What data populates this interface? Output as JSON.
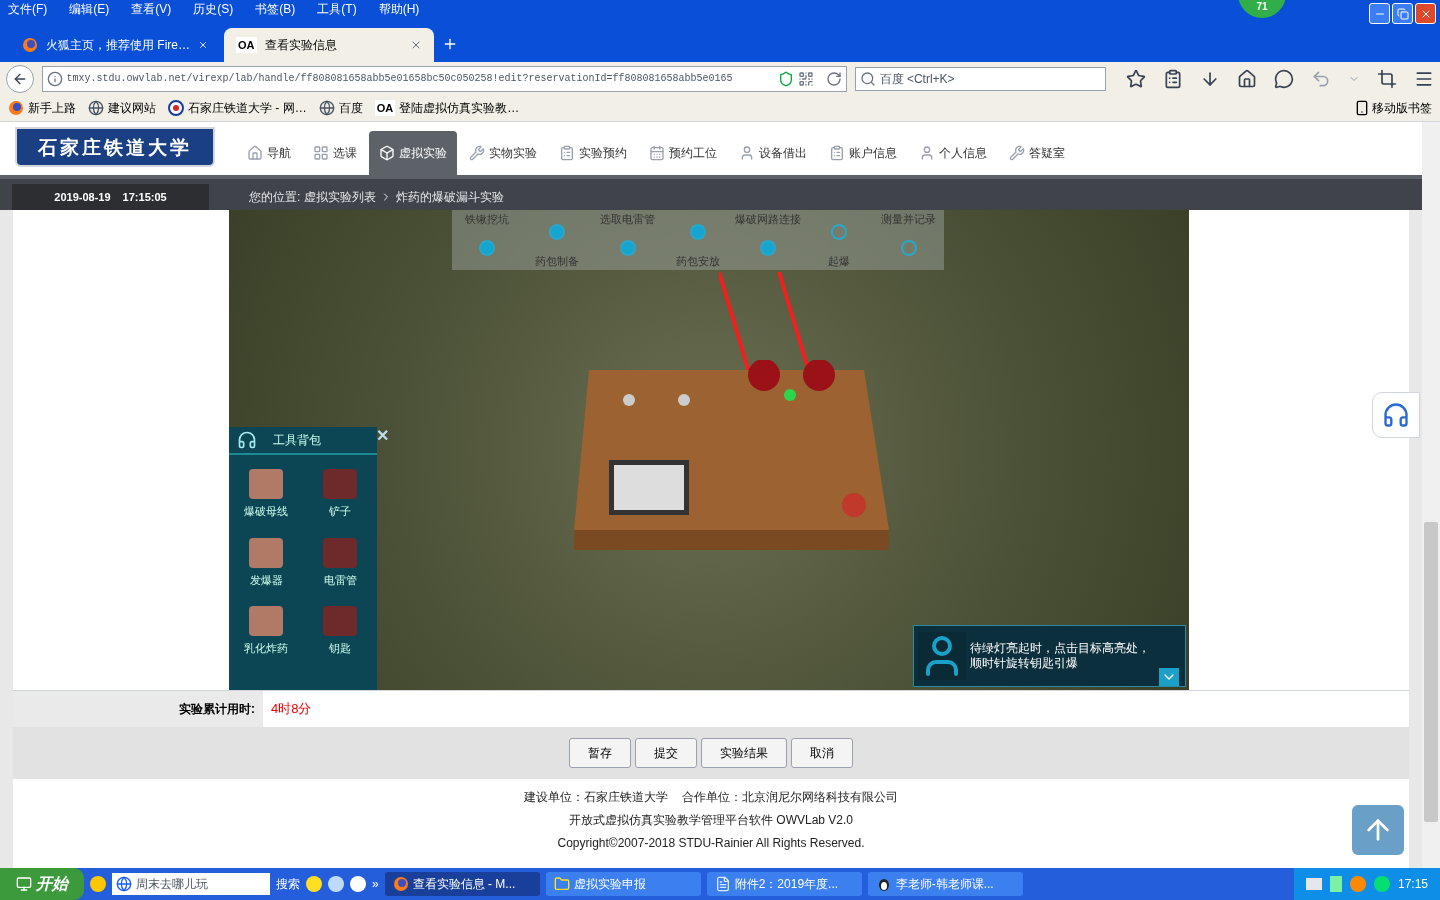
{
  "menu_bar": [
    "文件(F)",
    "编辑(E)",
    "查看(V)",
    "历史(S)",
    "书签(B)",
    "工具(T)",
    "帮助(H)"
  ],
  "notification_badge": "71",
  "tabs": [
    {
      "label": "火狐主页，推荐使用 Fire…",
      "selected": false
    },
    {
      "label": "查看实验信息",
      "selected": true,
      "icon": "OA"
    }
  ],
  "address_bar": {
    "url": "tmxy.stdu.owvlab.net/virexp/lab/handle/ff808081658abb5e01658bc50c050258!edit?reservationId=ff808081658abb5e0165",
    "search_placeholder": "百度 <Ctrl+K>"
  },
  "bookmarks": [
    {
      "label": "新手上路"
    },
    {
      "label": "建议网站"
    },
    {
      "label": "石家庄铁道大学 - 网…"
    },
    {
      "label": "百度"
    },
    {
      "label": "登陆虚拟仿真实验教…",
      "icon": "OA"
    }
  ],
  "mobile_bookmarks": "移动版书签",
  "site": {
    "logo": "石家庄铁道大学",
    "nav": [
      {
        "label": "导航",
        "selected": false
      },
      {
        "label": "选课",
        "selected": false
      },
      {
        "label": "虚拟实验",
        "selected": true
      },
      {
        "label": "实物实验",
        "selected": false
      },
      {
        "label": "实验预约",
        "selected": false
      },
      {
        "label": "预约工位",
        "selected": false
      },
      {
        "label": "设备借出",
        "selected": false
      },
      {
        "label": "账户信息",
        "selected": false
      },
      {
        "label": "个人信息",
        "selected": false
      },
      {
        "label": "答疑室",
        "selected": false
      }
    ],
    "date": "2019-08-19",
    "time": "17:15:05",
    "breadcrumb": {
      "prefix": "您的位置:",
      "items": [
        "虚拟实验列表",
        "炸药的爆破漏斗实验"
      ]
    }
  },
  "scene": {
    "steps": [
      {
        "label": "铁锹挖坑",
        "done": true
      },
      {
        "label": "药包制备",
        "done": true
      },
      {
        "label": "选取电雷管",
        "done": true
      },
      {
        "label": "药包安放",
        "done": true
      },
      {
        "label": "爆破网路连接",
        "done": true
      },
      {
        "label": "起爆",
        "done": false
      },
      {
        "label": "测量并记录",
        "done": false
      }
    ],
    "tool_bag": {
      "title": "工具背包",
      "close": "✕",
      "tools": [
        "爆破母线",
        "铲子",
        "发爆器",
        "电雷管",
        "乳化炸药",
        "钥匙"
      ]
    },
    "hint": "待绿灯亮起时，点击目标高亮处，顺时针旋转钥匙引爆"
  },
  "elapsed": {
    "label": "实验累计用时:",
    "value": "4时8分"
  },
  "buttons": [
    "暂存",
    "提交",
    "实验结果",
    "取消"
  ],
  "footer": [
    "建设单位：石家庄铁道大学    合作单位：北京润尼尔网络科技有限公司",
    "开放式虚拟仿真实验教学管理平台软件 OWVLab V2.0",
    "Copyright©2007-2018 STDU-Rainier All Rights Reserved."
  ],
  "taskbar": {
    "start": "开始",
    "search_field": "周末去哪儿玩",
    "search_button": "搜索",
    "more": "»",
    "tasks": [
      {
        "label": "查看实验信息 - M...",
        "selected": true
      },
      {
        "label": "虚拟实验申报",
        "selected": false
      },
      {
        "label": "附件2：2019年度...",
        "selected": false
      },
      {
        "label": "李老师-韩老师课...",
        "selected": false
      }
    ],
    "clock": "17:15"
  }
}
